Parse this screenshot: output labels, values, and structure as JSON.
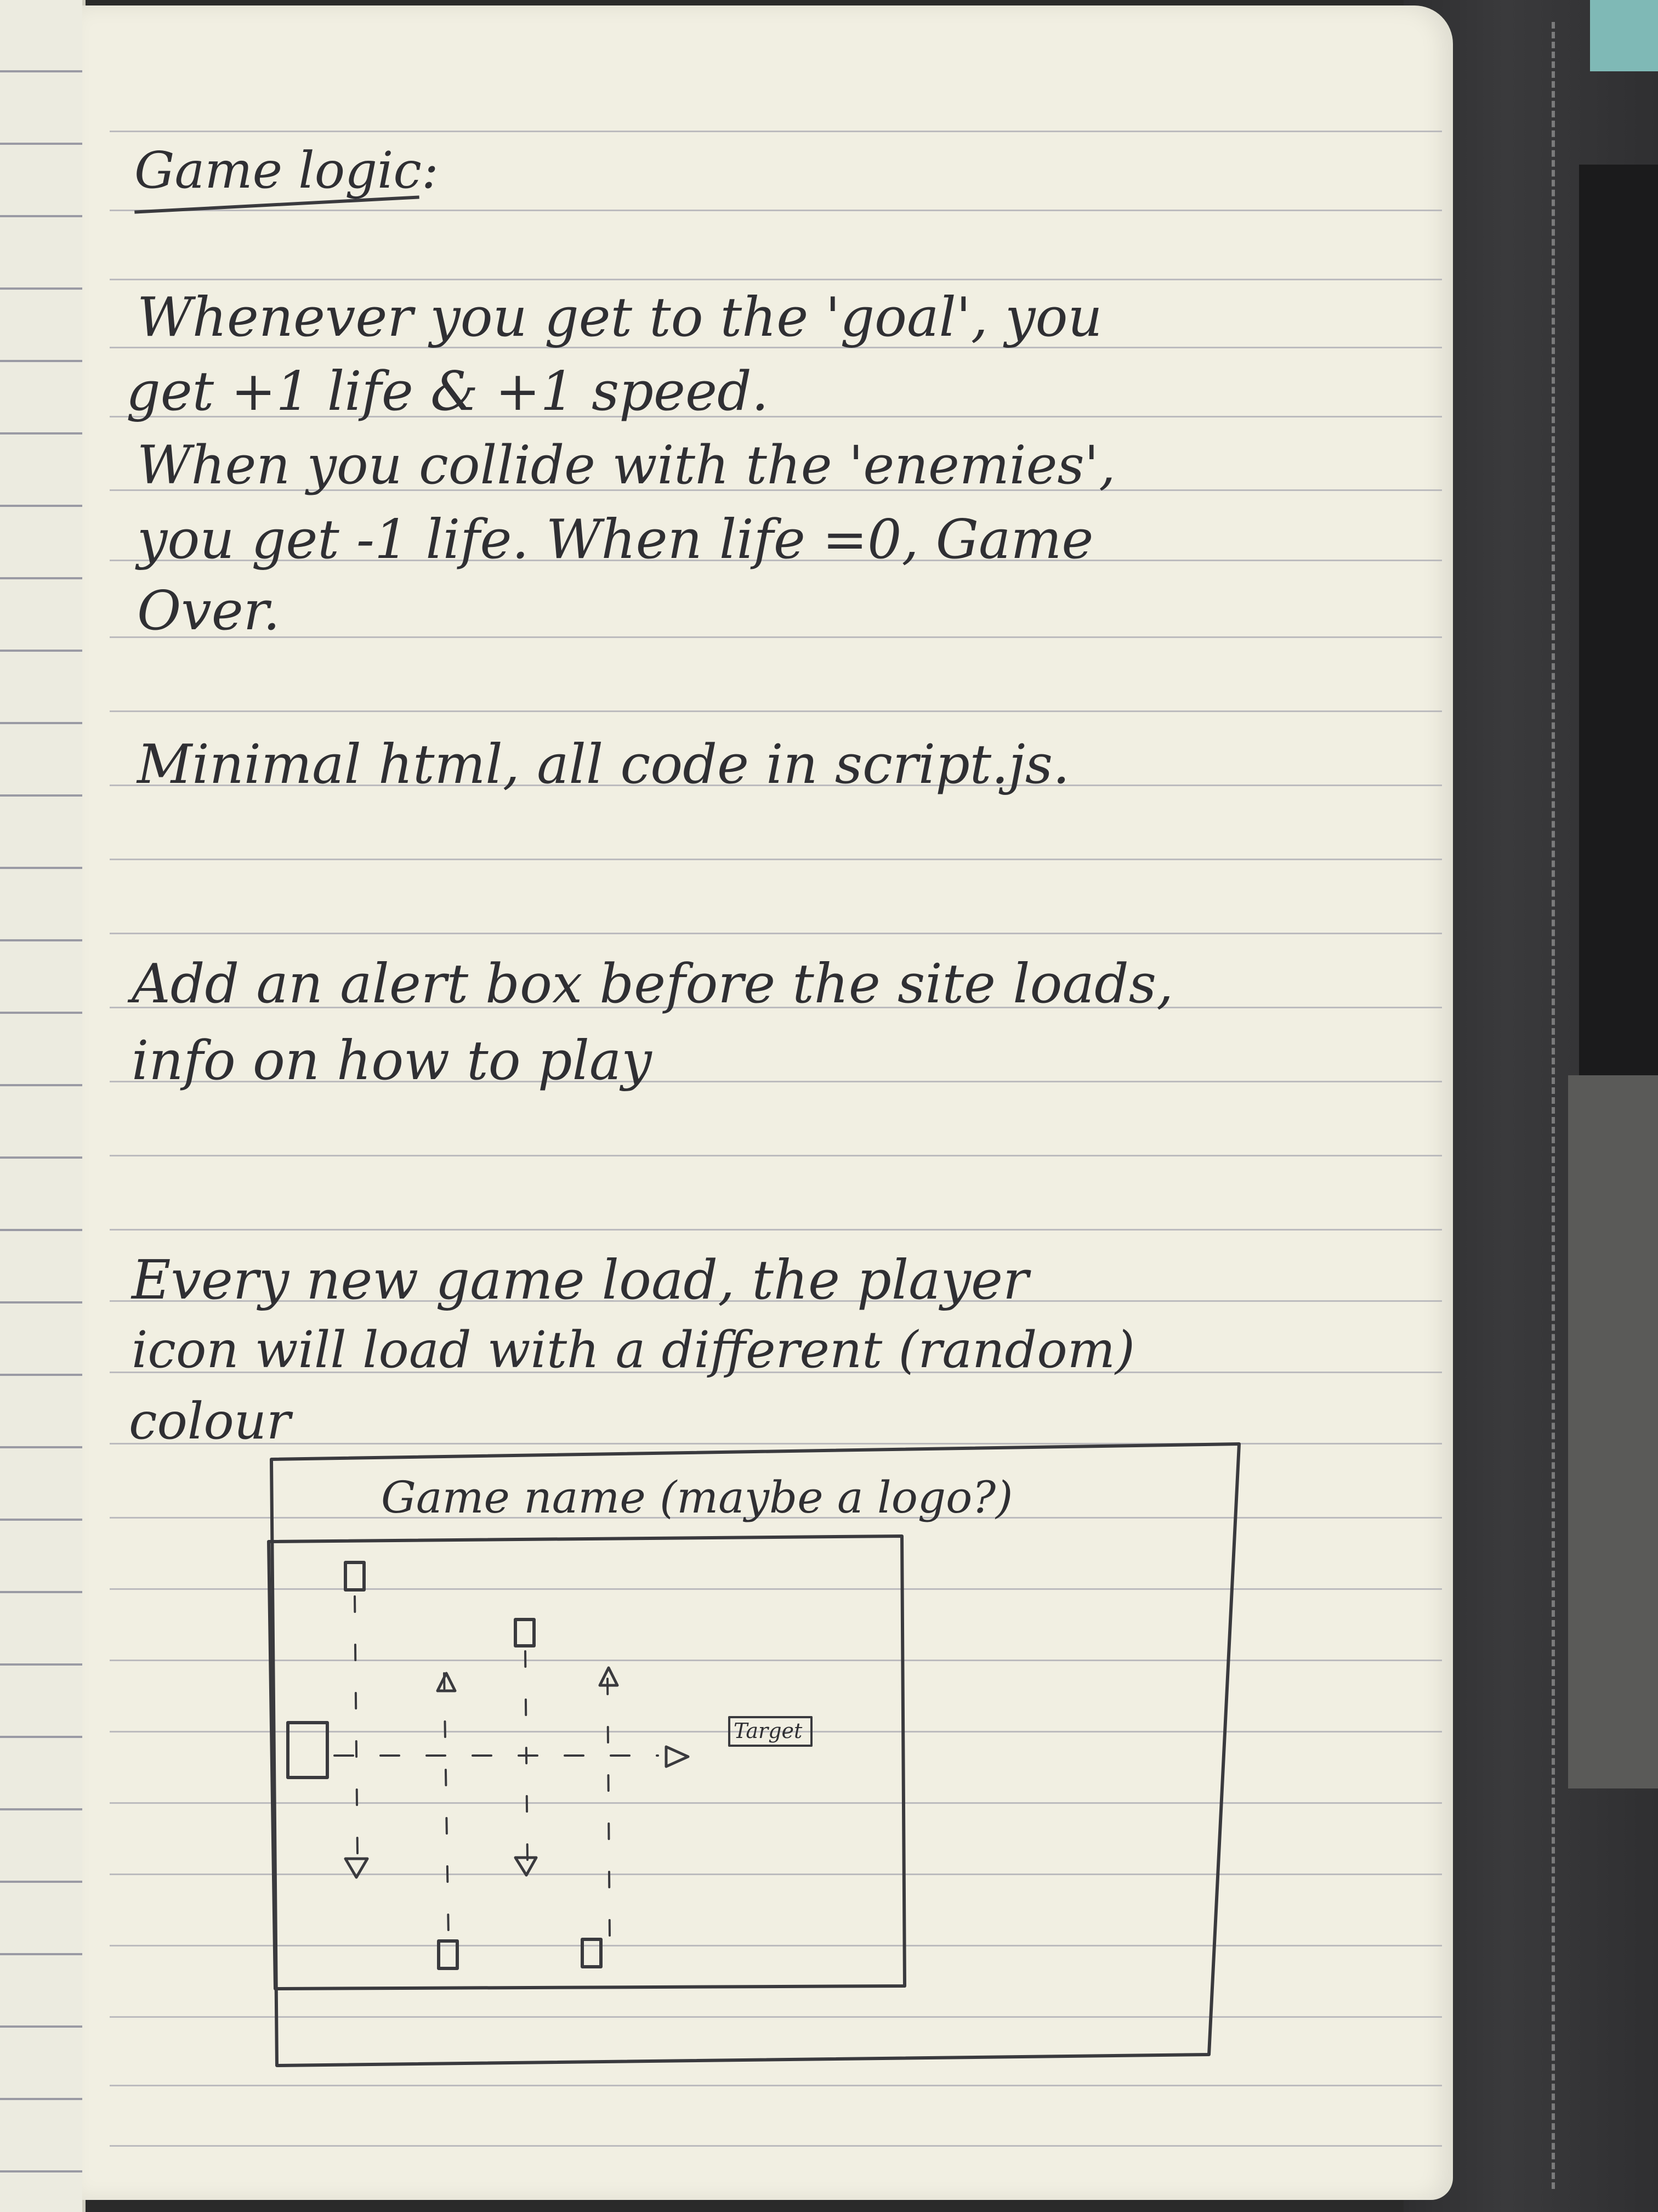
{
  "notebook": {
    "title": "Game logic:",
    "paragraphs": [
      {
        "lines": [
          "Whenever you get to the 'goal', you",
          "get +1 life & +1 speed.",
          "When you collide with the 'enemies',",
          "you get -1 life. When life =0, Game",
          "Over."
        ]
      },
      {
        "lines": [
          "Minimal html, all code in script.js."
        ]
      },
      {
        "lines": [
          "Add an alert box before the site loads,",
          "info on how to play"
        ]
      },
      {
        "lines": [
          "Every new game load, the player",
          "icon will load with a different (random)",
          "colour"
        ]
      }
    ],
    "sketch": {
      "header_label": "Game name (maybe a logo?)",
      "target_label": "Target"
    }
  },
  "colors": {
    "paper": "#f1efe2",
    "ink": "#2f2f33",
    "ruled_line": "#a9a9b2",
    "cover": "#343436"
  }
}
